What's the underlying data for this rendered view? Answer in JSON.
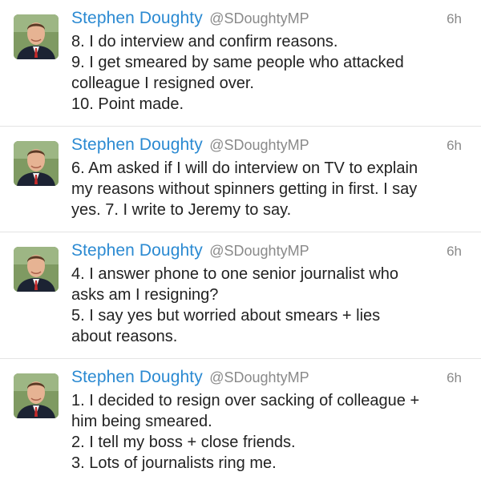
{
  "tweets": [
    {
      "name": "Stephen Doughty",
      "handle": "@SDoughtyMP",
      "time": "6h",
      "lines": [
        "8. I do interview and confirm reasons.",
        "9. I get smeared by same people who attacked",
        "colleague I resigned over.",
        "10. Point made."
      ]
    },
    {
      "name": "Stephen Doughty",
      "handle": "@SDoughtyMP",
      "time": "6h",
      "lines": [
        "6. Am asked if I will do interview on TV to explain",
        "my reasons without spinners getting in first. I say",
        "yes. 7. I write to Jeremy to say."
      ]
    },
    {
      "name": "Stephen Doughty",
      "handle": "@SDoughtyMP",
      "time": "6h",
      "lines": [
        "4. I answer phone to one senior journalist who",
        "asks am I resigning?",
        "5. I say yes but worried about smears + lies",
        "about reasons."
      ]
    },
    {
      "name": "Stephen Doughty",
      "handle": "@SDoughtyMP",
      "time": "6h",
      "lines": [
        "1. I decided to resign over sacking of colleague +",
        "him being smeared.",
        "2. I tell my boss + close friends.",
        "3. Lots of journalists ring me."
      ]
    }
  ],
  "colors": {
    "name": "#2b8ad2",
    "meta": "#8a8a8a",
    "text": "#222222",
    "divider": "#e4e4e4"
  },
  "icons": {
    "avatar": "profile-photo-icon"
  }
}
